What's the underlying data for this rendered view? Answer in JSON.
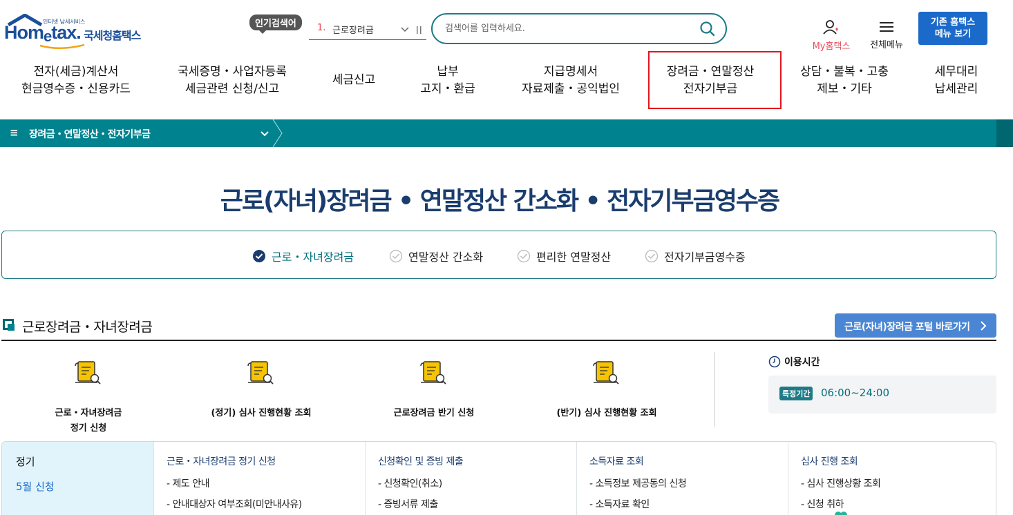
{
  "header": {
    "logo_small": "인터넷 납세서비스",
    "logo_word_a": "Hom",
    "logo_word_e": "e",
    "logo_word_b": "tax.",
    "logo_kr": "국세청홈택스",
    "popular_badge": "인기검색어",
    "popular_num": "1.",
    "popular_text": "근로장려금",
    "search_placeholder": "검색어를 입력하세요.",
    "mytax_label": "My홈택스",
    "allmenu_label": "전체메뉴",
    "old_menu_line1": "기존 홈택스",
    "old_menu_line2": "메뉴 보기"
  },
  "gnb": [
    {
      "l1": "전자(세금)계산서",
      "l2": "현금영수증・신용카드"
    },
    {
      "l1": "국세증명・사업자등록",
      "l2": "세금관련 신청/신고"
    },
    {
      "l1": "세금신고",
      "l2": ""
    },
    {
      "l1": "납부",
      "l2": "고지・환급"
    },
    {
      "l1": "지급명세서",
      "l2": "자료제출・공익법인"
    },
    {
      "l1": "장려금・연말정산",
      "l2": "전자기부금"
    },
    {
      "l1": "상담・불복・고충",
      "l2": "제보・기타"
    },
    {
      "l1": "세무대리",
      "l2": "납세관리"
    }
  ],
  "breadcrumb": {
    "menu_icon": "≡",
    "text": "장려금・연말정산・전자기부금"
  },
  "page_title": "근로(자녀)장려금 • 연말정산 간소화 • 전자기부금영수증",
  "tabs": [
    {
      "label": "근로・자녀장려금",
      "active": true
    },
    {
      "label": "연말정산 간소화",
      "active": false
    },
    {
      "label": "편리한 연말정산",
      "active": false
    },
    {
      "label": "전자기부금영수증",
      "active": false
    }
  ],
  "section": {
    "title": "근로장려금・자녀장려금",
    "portal_button": "근로(자녀)장려금 포털 바로가기"
  },
  "services": [
    {
      "l1": "근로・자녀장려금",
      "l2": "정기 신청"
    },
    {
      "l1": "(정기) 심사 진행현황 조회",
      "l2": ""
    },
    {
      "l1": "근로장려금 반기 신청",
      "l2": ""
    },
    {
      "l1": "(반기) 심사 진행현황 조회",
      "l2": ""
    }
  ],
  "usetime": {
    "label": "이용시간",
    "badge": "특정기간",
    "time": "06:00~24:00"
  },
  "table": {
    "lead_a": "정기",
    "lead_b": "5월 신청",
    "columns": [
      {
        "head": "근로・자녀장려금 정기 신청",
        "items": [
          "- 제도 안내",
          "- 안내대상자 여부조회(미안내사유)"
        ]
      },
      {
        "head": "신청확인 및 증빙 제출",
        "items": [
          "- 신청확인(취소)",
          "- 증빙서류 제출"
        ]
      },
      {
        "head": "소득자료 조회",
        "items": [
          "- 소득정보 제공동의 신청",
          "- 소득자료 확인"
        ]
      },
      {
        "head": "심사 진행 조회",
        "items": [
          "- 심사 진행상황 조회",
          "- 신청 취하"
        ]
      }
    ]
  },
  "colors": {
    "teal": "#00838f",
    "navy": "#1a3d6e",
    "blue": "#1b6ac9",
    "highlight": "#e2141e"
  }
}
